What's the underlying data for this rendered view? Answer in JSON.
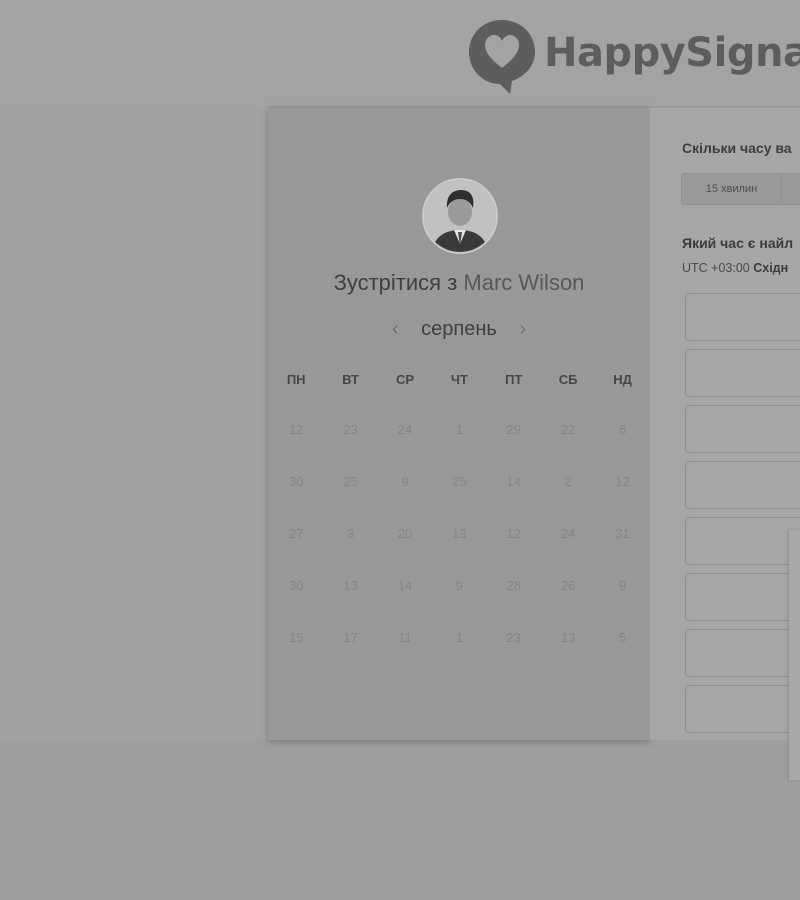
{
  "header": {
    "brand": "HappySigna",
    "logo_icon": "heart-speech-bubble-icon"
  },
  "booking": {
    "title_prefix": "Зустрітися з",
    "host_name": "Marc Wilson",
    "avatar_icon": "user-avatar",
    "calendar": {
      "month": "серпень",
      "prev_icon": "chevron-left-icon",
      "next_icon": "chevron-right-icon",
      "weekdays": [
        "ПН",
        "ВТ",
        "СР",
        "ЧТ",
        "ПТ",
        "СБ",
        "НД"
      ],
      "weeks": [
        [
          "12",
          "23",
          "24",
          "1",
          "29",
          "22",
          "8"
        ],
        [
          "30",
          "25",
          "9",
          "25",
          "14",
          "2",
          "12"
        ],
        [
          "27",
          "3",
          "20",
          "13",
          "12",
          "24",
          "31"
        ],
        [
          "30",
          "13",
          "14",
          "9",
          "28",
          "26",
          "9"
        ],
        [
          "15",
          "17",
          "11",
          "1",
          "23",
          "13",
          "5"
        ]
      ]
    }
  },
  "scheduler": {
    "duration_question": "Скільки часу ва",
    "duration_options": [
      "15 хвилин",
      ""
    ],
    "time_question": "Який час є найл",
    "timezone_offset": "UTC +03:00",
    "timezone_name": "Східн",
    "slot_count": 8
  }
}
